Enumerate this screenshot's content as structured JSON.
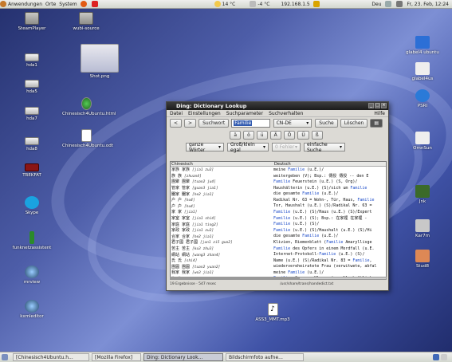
{
  "top_panel": {
    "menus": [
      "Anwendungen",
      "Orte",
      "System"
    ],
    "weather1": "14 °C",
    "weather2": "-4 °C",
    "ip": "192.168.1.5",
    "keyboard": "Deu",
    "datetime": "Fr, 23. Feb, 12:24"
  },
  "desktop_icons_left": [
    {
      "label": "SteamPlayer",
      "kind": "folder"
    },
    {
      "label": "hda1",
      "kind": "drive"
    },
    {
      "label": "hda5",
      "kind": "drive"
    },
    {
      "label": "hda7",
      "kind": "drive"
    },
    {
      "label": "hda8",
      "kind": "drive"
    },
    {
      "label": "TREKFAT",
      "kind": "drive"
    },
    {
      "label": "Skype",
      "kind": "app"
    },
    {
      "label": "funknetzassistent",
      "kind": "app"
    },
    {
      "label": "mrview",
      "kind": "app"
    },
    {
      "label": "kxmleditor",
      "kind": "app"
    }
  ],
  "desktop_icons_mid": [
    {
      "label": "wubi-source",
      "kind": "folder"
    },
    {
      "label": "Chinesisch4Ubuntu.html",
      "kind": "doc"
    },
    {
      "label": "Chinesisch4Ubuntu.odt",
      "kind": "doc"
    }
  ],
  "screenshot_thumb": "Shot.png",
  "desktop_icons_right": [
    {
      "label": "glabel4 ubuntu"
    },
    {
      "label": "glabel4us"
    },
    {
      "label": "PSRI"
    },
    {
      "label": "OmnSun"
    },
    {
      "label": "Jnk"
    },
    {
      "label": "Kar7m"
    },
    {
      "label": "Stud8"
    }
  ],
  "mp3_label": "ASS3_MMT.mp3",
  "window": {
    "title": "Ding: Dictionary Lookup",
    "menu": [
      "Datei",
      "Einstellungen",
      "Suchparameter",
      "Suchverhalten"
    ],
    "help": "Hilfe",
    "search_label": "Suchwort",
    "search_value": "Familie",
    "lang": "CN-DE",
    "search_btn": "Suche",
    "clear_btn": "Löschen",
    "umlauts": [
      "ä",
      "ö",
      "ü",
      "Ä",
      "Ö",
      "Ü",
      "ß"
    ],
    "opt_words": "ganze Wörter",
    "opt_case": "Groß/klein egal",
    "opt_errors": "0 Fehler",
    "opt_search": "einfache Suche",
    "col1": "Chinesisch",
    "col2": "Deutsch",
    "rows": [
      {
        "hanzi": "家族 家族",
        "pinyin": "[jia1 zu2]",
        "de": "meine Familie (u.E.)/"
      },
      {
        "hanzi": "族 族",
        "pinyin": "[zhuan4]",
        "de": "weitergeben (V); Bsp.: 傳授 傳授 -- den E"
      },
      {
        "hanzi": "團聚 團聚",
        "pinyin": "[tuan2 ju4]",
        "de": "Familie Feuerstein (u.E.) (S, Org)/"
      },
      {
        "hanzi": "管家 管家",
        "pinyin": "[guan3 jia1]",
        "de": "Haushälterin (u.E.) (S)/sich um Familie"
      },
      {
        "hanzi": "闔家 闔家",
        "pinyin": "[he2 jia1]",
        "de": "die gesamte Familie (u.E.)/"
      },
      {
        "hanzi": "户 户",
        "pinyin": "[hu4]",
        "de": "Radikal Nr. 63 = Wohn-, Tür, Haus, Familie"
      },
      {
        "hanzi": "户 户",
        "pinyin": "[hu4]",
        "de": "Tor, Haushalt (u.E.) (S)/Radikal Nr. 63 ="
      },
      {
        "hanzi": "家 家",
        "pinyin": "[jia1]",
        "de": "Familie (u.E.) (S)/Haus (u.E.) (S)/Expert"
      },
      {
        "hanzi": "家室 家室",
        "pinyin": "[jia1 shi4]",
        "de": "Familie (u.E.) (S); Bsp.: 在家裡 在家裡 -"
      },
      {
        "hanzi": "家庭 家庭",
        "pinyin": "[jia1 ting2]",
        "de": "Familie (u.E.) (S)/"
      },
      {
        "hanzi": "家政 家政",
        "pinyin": "[jia1 zu2]",
        "de": "Familie (u.E.) (S)/Haushalt (u.E.) (S)/Hi"
      },
      {
        "hanzi": "合家 合家",
        "pinyin": "[he2 jia1]",
        "de": "die gesamte Familie (u.E.)/"
      },
      {
        "hanzi": "君子國 君子國",
        "pinyin": "[jun1 zi5 guo2]",
        "de": "Klivien, Riemenblatt (Familie Amaryllisge"
      },
      {
        "hanzi": "苦主 苦主",
        "pinyin": "[ku3 zhu3]",
        "de": "Familie des Opfers in einem Mordfall (u.E."
      },
      {
        "hanzi": "網站 網站",
        "pinyin": "[wang3 zhan4]",
        "de": "Internet-Protokoll-Familie (u.E.) (S)/"
      },
      {
        "hanzi": "氏 氏",
        "pinyin": "[shi4]",
        "de": "Name (u.E.) (S)/Radikal Nr. 83 = Familie,"
      },
      {
        "hanzi": "團圓 團圓",
        "pinyin": "[tuan2 yuan2]",
        "de": "wiedervereheiratete Frau (verwitwete, abfal"
      },
      {
        "hanzi": "我家 我家",
        "pinyin": "[wo3 jia1]",
        "de": "meine Familie (u.E.)/"
      },
      {
        "hanzi": "族 族",
        "pinyin": "[zu2]",
        "de": "Familie, Gruppe, Klasse (gesellschaftlich"
      }
    ],
    "status_left": "19 Ergebnisse · 547 msec",
    "status_right": "/usr/share/trans/handedict.txt"
  },
  "taskbar": {
    "tasks": [
      {
        "label": "[Chinesisch4Ubuntu.h...",
        "active": false
      },
      {
        "label": "[Mozilla Firefox]",
        "active": false
      },
      {
        "label": "Ding: Dictionary Look...",
        "active": true
      },
      {
        "label": "Bildschirmfoto aufne...",
        "active": false
      }
    ]
  }
}
